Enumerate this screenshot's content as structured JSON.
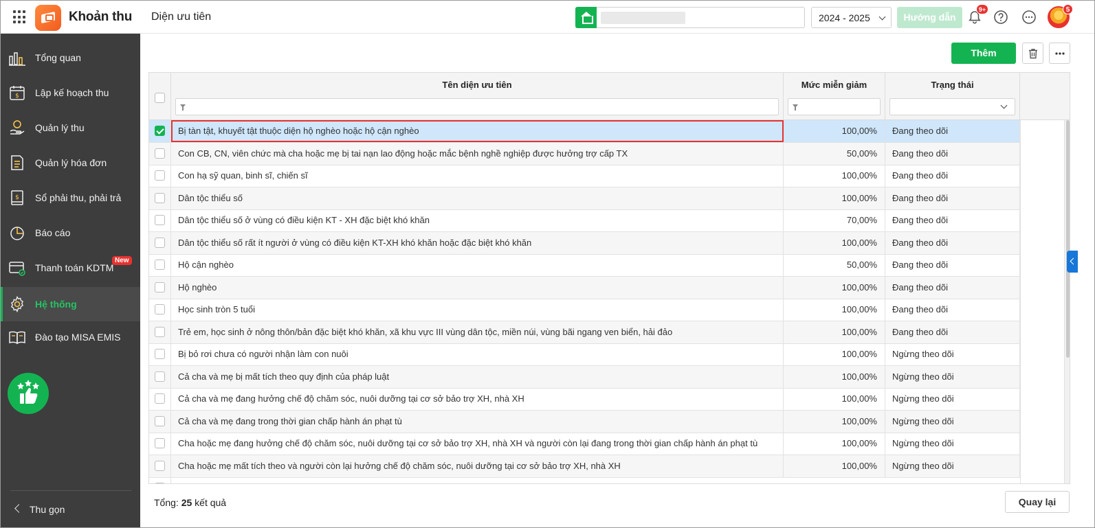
{
  "header": {
    "app_title": "Khoản thu",
    "page_title": "Diện ưu tiên",
    "school_year": "2024 - 2025",
    "guide_label": "Hướng dẫn",
    "notification_count": "9+",
    "avatar_badge": "5"
  },
  "sidebar": {
    "items": [
      {
        "label": "Tổng quan",
        "icon": "bar-chart-icon"
      },
      {
        "label": "Lập kế hoạch thu",
        "icon": "calendar-money-icon"
      },
      {
        "label": "Quản lý thu",
        "icon": "hand-coin-icon"
      },
      {
        "label": "Quản lý hóa đơn",
        "icon": "invoice-icon"
      },
      {
        "label": "Sổ phải thu, phải trả",
        "icon": "ledger-icon"
      },
      {
        "label": "Báo cáo",
        "icon": "pie-chart-icon"
      },
      {
        "label": "Thanh toán KDTM",
        "icon": "card-payment-icon",
        "badge": "New"
      },
      {
        "label": "Hệ thống",
        "icon": "gear-icon",
        "active": true
      },
      {
        "label": "Đào tạo MISA EMIS",
        "icon": "book-icon"
      }
    ],
    "collapse_label": "Thu gọn",
    "accent_color": "#14b352"
  },
  "toolbar": {
    "add_label": "Thêm"
  },
  "table": {
    "columns": [
      "Tên diện ưu tiên",
      "Mức miễn giảm",
      "Trạng thái"
    ],
    "rows": [
      {
        "name": "Bị tàn tật, khuyết tật thuộc diện hộ nghèo hoặc hộ cận nghèo",
        "rate": "100,00%",
        "status": "Đang theo dõi",
        "checked": true
      },
      {
        "name": "Con CB, CN, viên chức mà cha hoặc mẹ bị tai nạn lao động hoặc mắc bệnh nghề nghiệp được hưởng trợ cấp TX",
        "rate": "50,00%",
        "status": "Đang theo dõi"
      },
      {
        "name": "Con hạ sỹ quan, binh sĩ, chiến sĩ",
        "rate": "100,00%",
        "status": "Đang theo dõi"
      },
      {
        "name": "Dân tộc thiểu số",
        "rate": "100,00%",
        "status": "Đang theo dõi"
      },
      {
        "name": "Dân tộc thiểu số ở vùng có điều kiện KT - XH đặc biệt khó khăn",
        "rate": "70,00%",
        "status": "Đang theo dõi"
      },
      {
        "name": "Dân tộc thiểu số rất ít người ở vùng có điều kiện KT-XH khó khăn hoặc đặc biệt khó khăn",
        "rate": "100,00%",
        "status": "Đang theo dõi"
      },
      {
        "name": "Hộ cận nghèo",
        "rate": "50,00%",
        "status": "Đang theo dõi"
      },
      {
        "name": "Hộ nghèo",
        "rate": "100,00%",
        "status": "Đang theo dõi"
      },
      {
        "name": "Học sinh tròn 5 tuổi",
        "rate": "100,00%",
        "status": "Đang theo dõi"
      },
      {
        "name": "Trẻ em, học sinh ở nông thôn/bản đặc biệt khó khăn, xã khu vực III vùng dân tộc, miền núi, vùng bãi ngang ven biển, hải đảo",
        "rate": "100,00%",
        "status": "Đang theo dõi"
      },
      {
        "name": "Bị bỏ rơi chưa có người nhận làm con nuôi",
        "rate": "100,00%",
        "status": "Ngừng theo dõi"
      },
      {
        "name": "Cả cha và mẹ bị mất tích theo quy định của pháp luật",
        "rate": "100,00%",
        "status": "Ngừng theo dõi"
      },
      {
        "name": "Cả cha và mẹ đang hưởng chế độ chăm sóc, nuôi dưỡng tại cơ sở bảo trợ XH, nhà XH",
        "rate": "100,00%",
        "status": "Ngừng theo dõi"
      },
      {
        "name": "Cả cha và mẹ đang trong thời gian chấp hành án phạt tù",
        "rate": "100,00%",
        "status": "Ngừng theo dõi"
      },
      {
        "name": "Cha hoặc mẹ đang hưởng chế độ chăm sóc, nuôi dưỡng tại cơ sở bảo trợ XH, nhà XH và người còn lại đang trong thời gian chấp hành án phạt tù",
        "rate": "100,00%",
        "status": "Ngừng theo dõi"
      },
      {
        "name": "Cha hoặc mẹ mất tích theo và người còn lại hưởng chế độ chăm sóc, nuôi dưỡng tại cơ sở bảo trợ XH, nhà XH",
        "rate": "100,00%",
        "status": "Ngừng theo dõi"
      }
    ]
  },
  "footer": {
    "total_prefix": "Tổng:",
    "total_count": "25",
    "total_suffix": "kết quả",
    "back_label": "Quay lại"
  }
}
